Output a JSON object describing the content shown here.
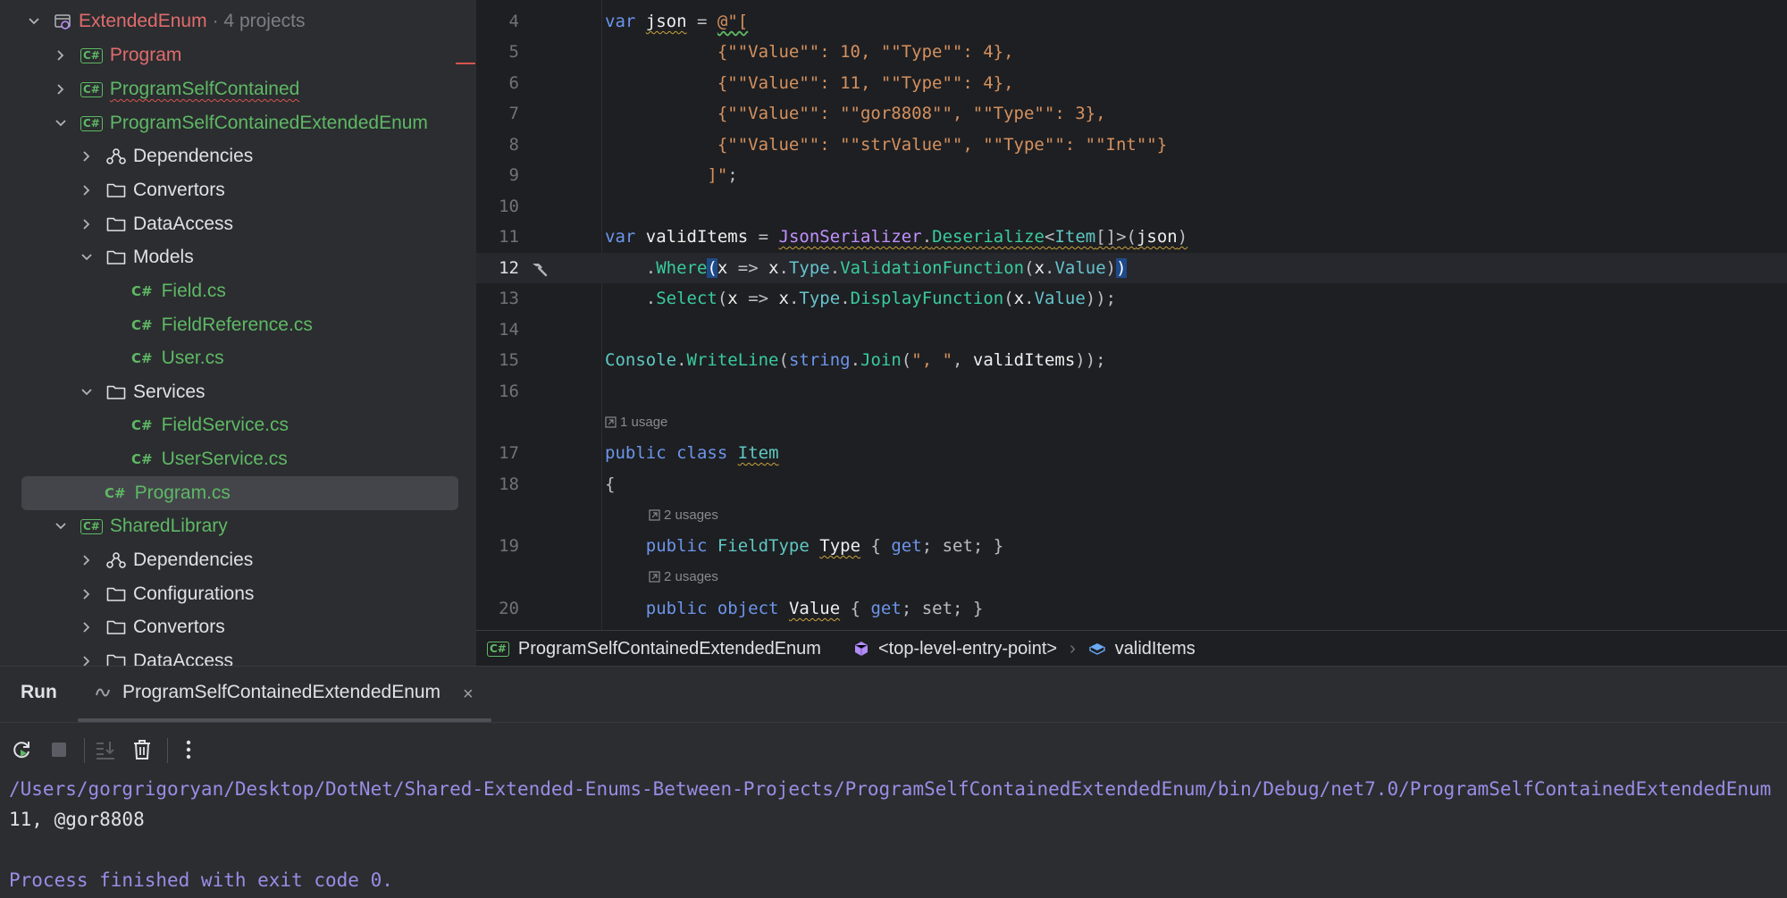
{
  "tree": {
    "root": {
      "label": "ExtendedEnum",
      "meta": "· 4 projects"
    },
    "items": [
      {
        "label": "Program"
      },
      {
        "label": "ProgramSelfContained"
      },
      {
        "label": "ProgramSelfContainedExtendedEnum"
      },
      {
        "label": "Dependencies"
      },
      {
        "label": "Convertors"
      },
      {
        "label": "DataAccess"
      },
      {
        "label": "Models"
      },
      {
        "label": "Field.cs"
      },
      {
        "label": "FieldReference.cs"
      },
      {
        "label": "User.cs"
      },
      {
        "label": "Services"
      },
      {
        "label": "FieldService.cs"
      },
      {
        "label": "UserService.cs"
      },
      {
        "label": "Program.cs"
      },
      {
        "label": "SharedLibrary"
      },
      {
        "label": "Dependencies"
      },
      {
        "label": "Configurations"
      },
      {
        "label": "Convertors"
      },
      {
        "label": "DataAccess"
      }
    ],
    "badge_text": "C#",
    "file_badge": "C#"
  },
  "editor": {
    "line_numbers": [
      "4",
      "5",
      "6",
      "7",
      "8",
      "9",
      "10",
      "11",
      "12",
      "13",
      "14",
      "15",
      "16",
      "17",
      "18",
      "19",
      "20"
    ],
    "lines": {
      "l4": [
        "var",
        " ",
        "json",
        " = ",
        "@\"["
      ],
      "l5": "           {\"\"Value\"\": 10, \"\"Type\"\": 4},",
      "l6": "           {\"\"Value\"\": 11, \"\"Type\"\": 4},",
      "l7": "           {\"\"Value\"\": \"\"gor8808\"\", \"\"Type\"\": 3},",
      "l8": "           {\"\"Value\"\": \"\"strValue\"\", \"\"Type\"\": \"\"Int\"\"}",
      "l9": "          ]\"",
      "l9b": ";",
      "l11": [
        "var",
        "validItems",
        "=",
        "JsonSerializer",
        "Deserialize",
        "Item",
        "json"
      ],
      "l12": [
        "Where",
        "x",
        "x",
        "Type",
        "ValidationFunction",
        "x",
        "Value"
      ],
      "l13": [
        "Select",
        "x",
        "x",
        "Type",
        "DisplayFunction",
        "x",
        "Value"
      ],
      "l15": [
        "Console",
        "WriteLine",
        "string",
        "Join",
        "\", \"",
        "validItems"
      ],
      "l17": [
        "public",
        "class",
        "Item"
      ],
      "l18": "{",
      "l19": [
        "public",
        "FieldType",
        "Type",
        "get",
        "set"
      ],
      "l20": [
        "public",
        "object",
        "Value",
        "get",
        "set"
      ]
    },
    "hints": {
      "h1": "1 usage",
      "h2": "2 usages",
      "h3": "2 usages"
    }
  },
  "breadcrumb": {
    "project": "ProgramSelfContainedExtendedEnum",
    "entry": "<top-level-entry-point>",
    "symbol": "validItems"
  },
  "run": {
    "title": "Run",
    "tab_label": "ProgramSelfContainedExtendedEnum",
    "output_path": "/Users/gorgrigoryan/Desktop/DotNet/Shared-Extended-Enums-Between-Projects/ProgramSelfContainedExtendedEnum/bin/Debug/net7.0/ProgramSelfContainedExtendedEnum",
    "output_line": "11, @gor8808",
    "exit_message": "Process finished with exit code 0."
  },
  "colors": {
    "accent_green": "#5fb865",
    "error_red": "#e06c6c",
    "keyword_blue": "#6c95eb",
    "string_orange": "#d4915f",
    "console_path": "#9b8ce6"
  }
}
